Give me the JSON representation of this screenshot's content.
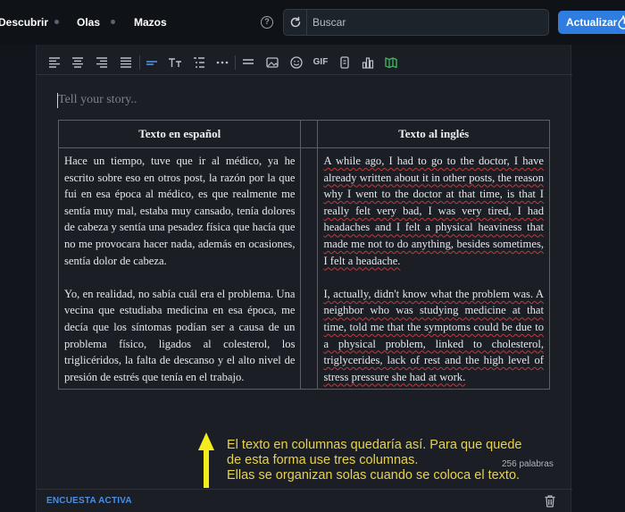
{
  "nav": {
    "links": [
      "Descubrir",
      "Olas",
      "Mazos"
    ],
    "help_icon": "?",
    "search_placeholder": "Buscar",
    "update_button": "Actualizar"
  },
  "toolbar": {
    "icons": [
      "align-left-icon",
      "align-center-icon",
      "align-right-icon",
      "align-justify-icon",
      "heading-icon",
      "text-size-icon",
      "list-icon",
      "more-icon",
      "divider-icon",
      "image-icon",
      "emoji-icon",
      "gif-icon",
      "chart-icon",
      "columns-icon"
    ],
    "gif_label": "GIF",
    "active_color": "#4f95f0",
    "columns_color": "#3fb560"
  },
  "editor": {
    "placeholder": "Tell your story..",
    "table": {
      "headers": [
        "Texto en español",
        "",
        "Texto al inglés"
      ],
      "spanish": [
        "Hace un tiempo, tuve que ir al médico, ya he escrito sobre eso en otros post, la razón por la que fui en esa época al médico, es que realmente me sentía muy mal, estaba muy cansado, tenía dolores de cabeza y sentía una pesadez física que hacía que no me provocara hacer nada, además en ocasiones, sentía dolor de cabeza.",
        "Yo, en realidad, no sabía cuál era el problema. Una vecina que estudiaba medicina en esa época, me decía que los síntomas podían ser a causa de un problema físico, ligados al colesterol, los triglicéridos, la falta de descanso y el alto nivel de presión de estrés que tenía en el trabajo."
      ],
      "english": [
        "A while ago, I had to go to the doctor, I have already written about it in other posts, the reason why I went to the doctor at that time, is that I really felt very bad, I was very tired, I had headaches and I felt a physical heaviness that made me not to do anything, besides sometimes, I felt a headache.",
        "I, actually, didn't know what the problem was. A neighbor who was studying medicine at that time, told me that the symptoms could be due to a physical problem, linked to cholesterol, triglycerides, lack of rest and the high level of stress pressure she had at work."
      ]
    },
    "annotation": [
      "El texto en columnas quedaría así. Para que quede",
      "de esta forma use tres columnas.",
      "Ellas se organizan solas cuando se coloca el texto."
    ],
    "word_count": "256 palabras",
    "poll_label": "ENCUESTA ACTIVA"
  },
  "colors": {
    "accent": "#2f7de1",
    "annotation": "#e8d24a",
    "poll": "#4a8fe6"
  }
}
